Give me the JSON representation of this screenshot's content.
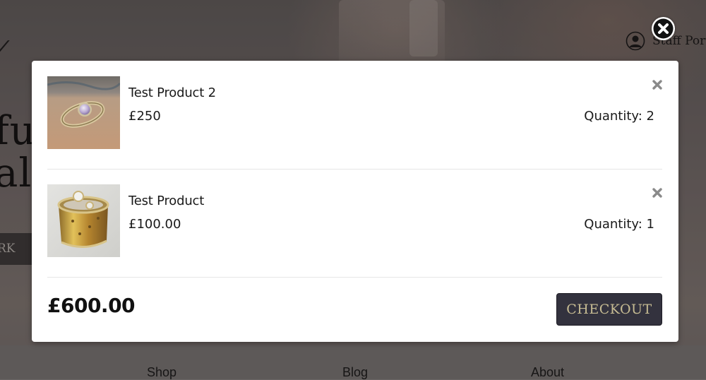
{
  "background": {
    "hero_lines": [
      "ful",
      "al"
    ],
    "hero_button_label": "RK",
    "staff_portal_label": "Staff Portal",
    "nav": [
      {
        "label": "Shop"
      },
      {
        "label": "Blog"
      },
      {
        "label": "About"
      }
    ]
  },
  "cart": {
    "items": [
      {
        "name": "Test Product 2",
        "price": "£250",
        "quantity_label": "Quantity: 2",
        "thumbnail_icon": "ring-amethyst-image"
      },
      {
        "name": "Test Product",
        "price": "£100.00",
        "quantity_label": "Quantity: 1",
        "thumbnail_icon": "ring-gold-band-image"
      }
    ],
    "total": "£600.00",
    "checkout_label": "CHECKOUT"
  },
  "icons": {
    "modal_close": "close-circle-icon",
    "remove_item": "close-icon",
    "staff_portal": "user-icon"
  },
  "colors": {
    "checkout_bg": "#33323e",
    "checkout_text": "#c7bc93",
    "modal_bg": "#ffffff"
  }
}
